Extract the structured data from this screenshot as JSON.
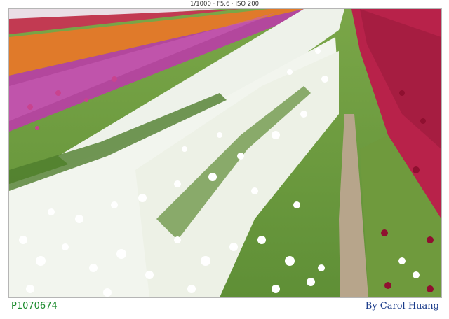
{
  "header": {
    "exif": "1/1000 · F5.6 · ISO 200"
  },
  "footer": {
    "id": "P1070674",
    "credit": "By Carol Huang"
  },
  "colors": {
    "id_text": "#1a8a2c",
    "credit_text": "#1a3b8a",
    "frame_border": "#b5b5b5"
  }
}
